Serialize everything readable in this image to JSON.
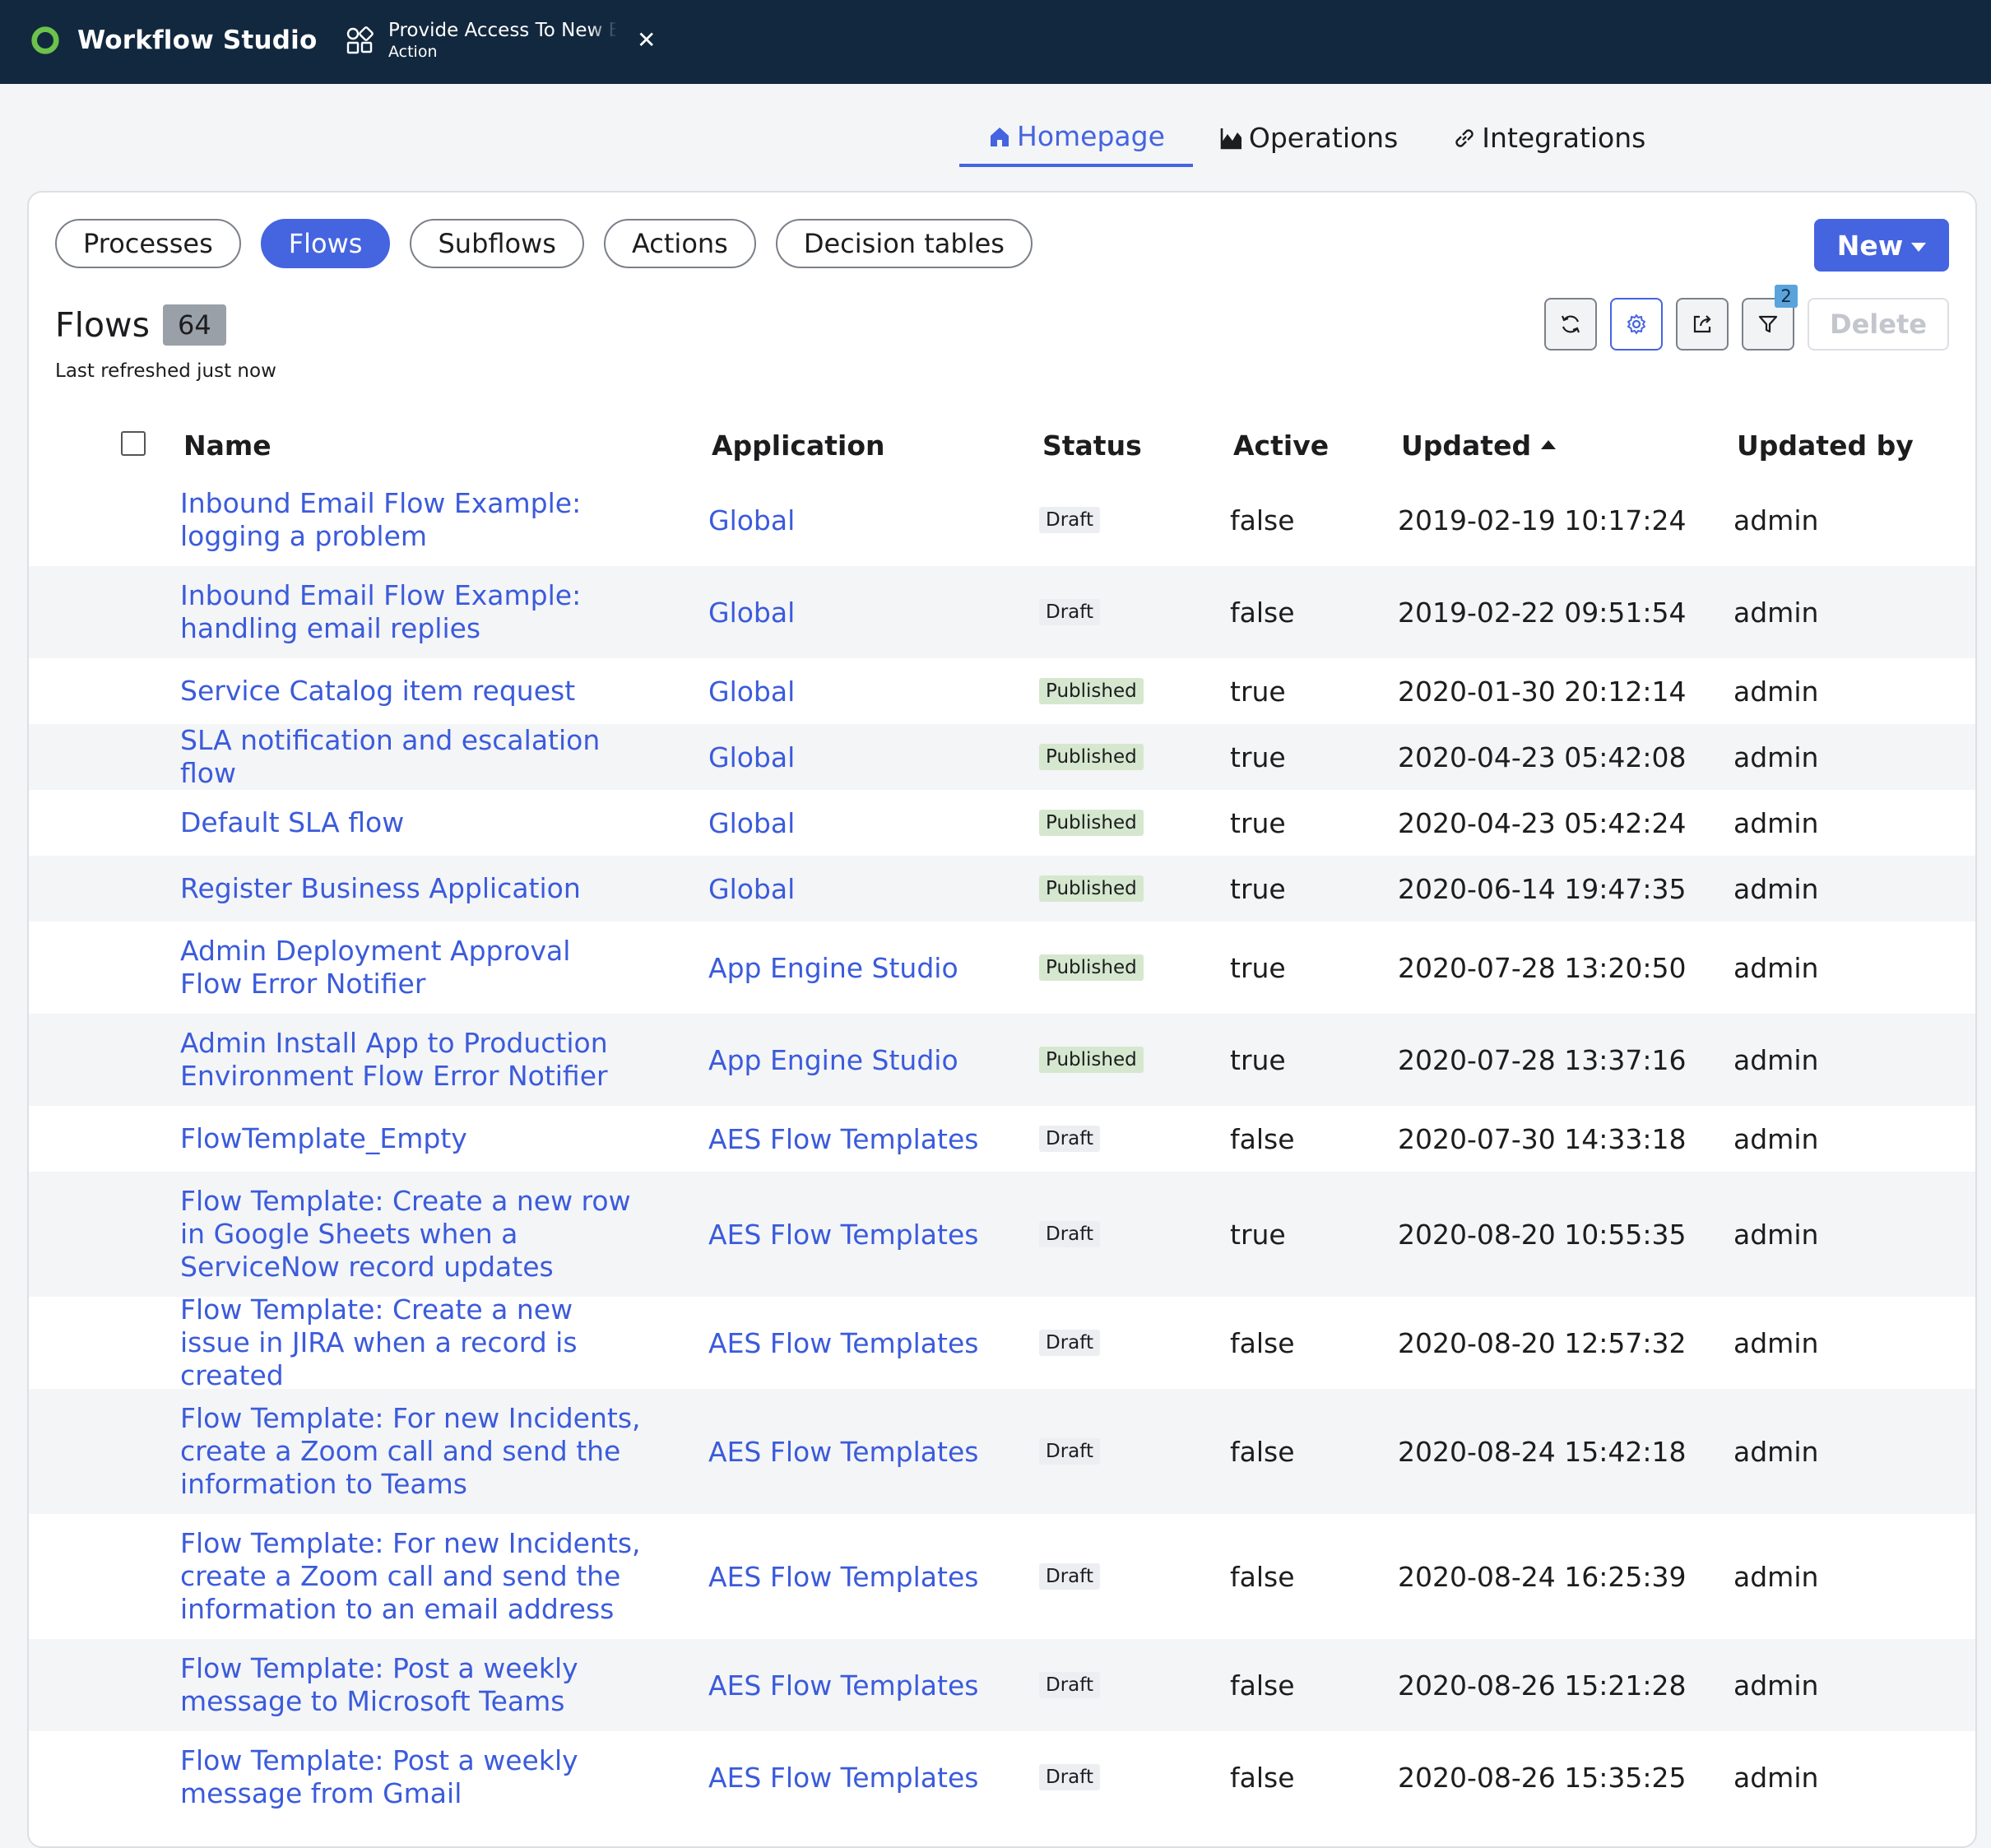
{
  "topbar": {
    "brand": "Workflow Studio",
    "tab": {
      "title": "Provide Access To New E",
      "subtitle": "Action"
    },
    "colors": {
      "background": "#12283e",
      "logo": "#6cc24a"
    }
  },
  "nav": {
    "items": [
      {
        "label": "Homepage",
        "icon": "home-icon",
        "active": true
      },
      {
        "label": "Operations",
        "icon": "chart-icon"
      },
      {
        "label": "Integrations",
        "icon": "link-icon"
      }
    ]
  },
  "pills": [
    {
      "label": "Processes"
    },
    {
      "label": "Flows",
      "active": true
    },
    {
      "label": "Subflows"
    },
    {
      "label": "Actions"
    },
    {
      "label": "Decision tables"
    }
  ],
  "new_button": "New",
  "list": {
    "title": "Flows",
    "count": "64",
    "refreshed": "Last refreshed just now"
  },
  "toolbar": {
    "filter_count": "2",
    "delete_label": "Delete"
  },
  "table": {
    "headers": {
      "name": "Name",
      "application": "Application",
      "status": "Status",
      "active": "Active",
      "updated": "Updated",
      "updated_by": "Updated by"
    },
    "rows": [
      {
        "name": "Inbound Email Flow Example: logging a problem",
        "application": "Global",
        "status": "Draft",
        "active": "false",
        "updated": "2019-02-19 10:17:24",
        "updated_by": "admin"
      },
      {
        "name": "Inbound Email Flow Example: handling email replies",
        "application": "Global",
        "status": "Draft",
        "active": "false",
        "updated": "2019-02-22 09:51:54",
        "updated_by": "admin"
      },
      {
        "name": "Service Catalog item request",
        "application": "Global",
        "status": "Published",
        "active": "true",
        "updated": "2020-01-30 20:12:14",
        "updated_by": "admin"
      },
      {
        "name": "SLA notification and escalation flow",
        "application": "Global",
        "status": "Published",
        "active": "true",
        "updated": "2020-04-23 05:42:08",
        "updated_by": "admin"
      },
      {
        "name": "Default SLA flow",
        "application": "Global",
        "status": "Published",
        "active": "true",
        "updated": "2020-04-23 05:42:24",
        "updated_by": "admin"
      },
      {
        "name": "Register Business Application",
        "application": "Global",
        "status": "Published",
        "active": "true",
        "updated": "2020-06-14 19:47:35",
        "updated_by": "admin"
      },
      {
        "name": "Admin Deployment Approval Flow Error Notifier",
        "application": "App Engine Studio",
        "status": "Published",
        "active": "true",
        "updated": "2020-07-28 13:20:50",
        "updated_by": "admin"
      },
      {
        "name": "Admin Install App to Production Environment Flow Error Notifier",
        "application": "App Engine Studio",
        "status": "Published",
        "active": "true",
        "updated": "2020-07-28 13:37:16",
        "updated_by": "admin"
      },
      {
        "name": "FlowTemplate_Empty",
        "application": "AES Flow Templates",
        "status": "Draft",
        "active": "false",
        "updated": "2020-07-30 14:33:18",
        "updated_by": "admin"
      },
      {
        "name": "Flow Template: Create a new row in Google Sheets when a ServiceNow record updates",
        "application": "AES Flow Templates",
        "status": "Draft",
        "active": "true",
        "updated": "2020-08-20 10:55:35",
        "updated_by": "admin"
      },
      {
        "name": "Flow Template: Create a new issue in JIRA when a record is created",
        "application": "AES Flow Templates",
        "status": "Draft",
        "active": "false",
        "updated": "2020-08-20 12:57:32",
        "updated_by": "admin"
      },
      {
        "name": "Flow Template: For new Incidents, create a Zoom call and send the information to Teams",
        "application": "AES Flow Templates",
        "status": "Draft",
        "active": "false",
        "updated": "2020-08-24 15:42:18",
        "updated_by": "admin"
      },
      {
        "name": "Flow Template: For new Incidents, create a Zoom call and send the information to an email address",
        "application": "AES Flow Templates",
        "status": "Draft",
        "active": "false",
        "updated": "2020-08-24 16:25:39",
        "updated_by": "admin"
      },
      {
        "name": "Flow Template: Post a weekly message to Microsoft Teams",
        "application": "AES Flow Templates",
        "status": "Draft",
        "active": "false",
        "updated": "2020-08-26 15:21:28",
        "updated_by": "admin"
      },
      {
        "name": "Flow Template: Post a weekly message from Gmail",
        "application": "AES Flow Templates",
        "status": "Draft",
        "active": "false",
        "updated": "2020-08-26 15:35:25",
        "updated_by": "admin"
      }
    ]
  },
  "colors": {
    "accent": "#4564e0",
    "link": "#3b5bdb",
    "published": "#d5e8cf",
    "draft": "#eceef1"
  }
}
